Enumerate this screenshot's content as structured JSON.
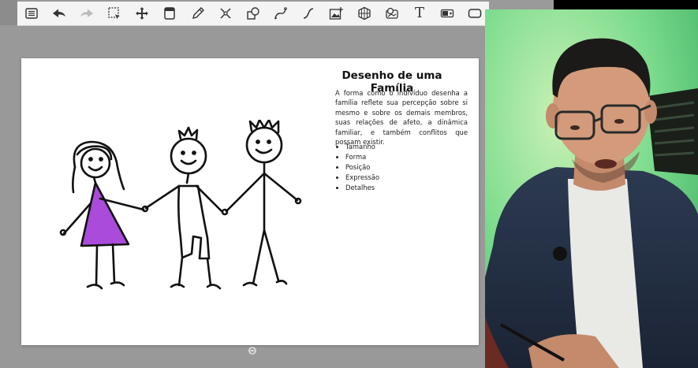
{
  "toolbar": {
    "tools": [
      {
        "name": "menu-icon"
      },
      {
        "name": "undo-icon"
      },
      {
        "name": "redo-icon"
      },
      {
        "name": "selection-icon"
      },
      {
        "name": "move-icon"
      },
      {
        "name": "page-icon"
      },
      {
        "name": "pen-icon"
      },
      {
        "name": "transform-icon"
      },
      {
        "name": "shapes-icon"
      },
      {
        "name": "curve-icon"
      },
      {
        "name": "line-icon"
      },
      {
        "name": "image-icon"
      },
      {
        "name": "grid-icon"
      },
      {
        "name": "stamp-icon"
      },
      {
        "name": "text-icon",
        "glyph": "T"
      },
      {
        "name": "video-icon"
      },
      {
        "name": "frame-icon"
      }
    ]
  },
  "slide": {
    "title": "Desenho de uma Família",
    "body": "A forma como o indivíduo desenha a família reflete sua percepção sobre si mesmo e sobre os demais membros, suas relações de afeto, a dinâmica familiar, e também conflitos que possam existir.",
    "bullets": [
      "Tamanho",
      "Forma",
      "Posição",
      "Expressão",
      "Detalhes"
    ]
  },
  "colors": {
    "workspace": "#999999",
    "toolbar": "#f4f4f4",
    "dress": "#9b2bd6",
    "webcam_bg": "#6fd496"
  }
}
